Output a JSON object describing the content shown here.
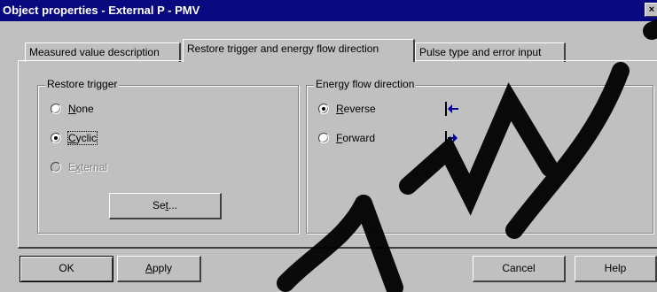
{
  "window": {
    "title": "Object properties - External P - PMV",
    "close_label": "×"
  },
  "tabs": [
    {
      "label": "Measured value description",
      "active": false
    },
    {
      "label": "Restore trigger and energy flow direction",
      "active": true
    },
    {
      "label": "Pulse type and error input",
      "active": false
    }
  ],
  "restore_trigger": {
    "legend": "Restore trigger",
    "options": [
      {
        "label": "None",
        "checked": false,
        "disabled": false
      },
      {
        "label": "Cyclic",
        "checked": true,
        "disabled": false
      },
      {
        "label": "External",
        "checked": false,
        "disabled": true
      }
    ],
    "set_button": "Set..."
  },
  "energy_flow": {
    "legend": "Energy flow direction",
    "options": [
      {
        "label": "Reverse",
        "checked": true,
        "icon": "arrow-left-icon"
      },
      {
        "label": "Forward",
        "checked": false,
        "icon": "arrow-right-icon"
      }
    ]
  },
  "buttons": {
    "ok": "OK",
    "apply": "Apply",
    "cancel": "Cancel",
    "help": "Help"
  },
  "colors": {
    "titlebar": "#0a0a80",
    "face": "#c0c0c0",
    "icon_blue": "#0000a0"
  }
}
